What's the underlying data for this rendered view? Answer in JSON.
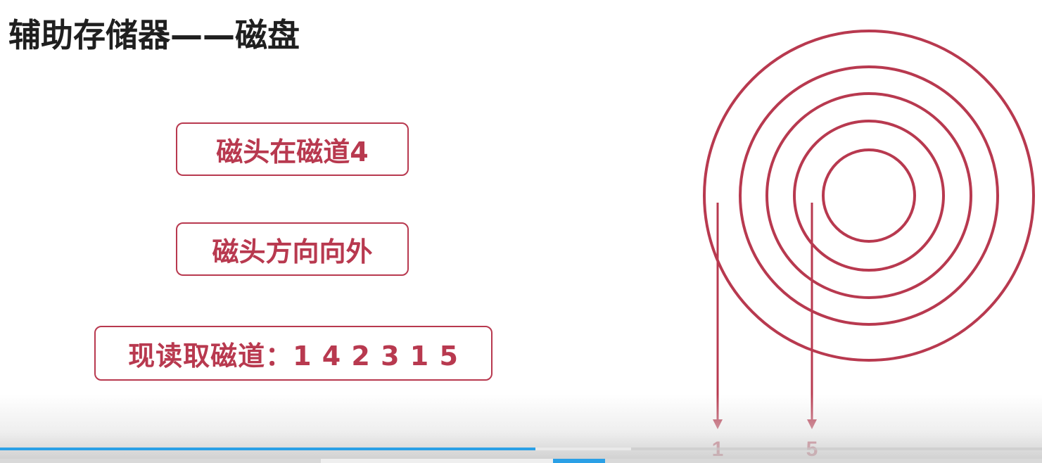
{
  "slide": {
    "title": "辅助存储器——磁盘",
    "boxes": {
      "head_position": "磁头在磁道4",
      "head_direction": "磁头方向向外",
      "read_sequence": "现读取磁道：1 4 2 3 1 5"
    }
  },
  "disk": {
    "track_count": 5,
    "arrow_labels": {
      "left": "1",
      "right": "5"
    }
  },
  "colors": {
    "accent": "#b8394f",
    "title": "#1f1f1f",
    "progress": "#2aa0e6"
  },
  "player": {
    "progress_fraction": 0.514,
    "buffered_fraction": 0.606
  }
}
